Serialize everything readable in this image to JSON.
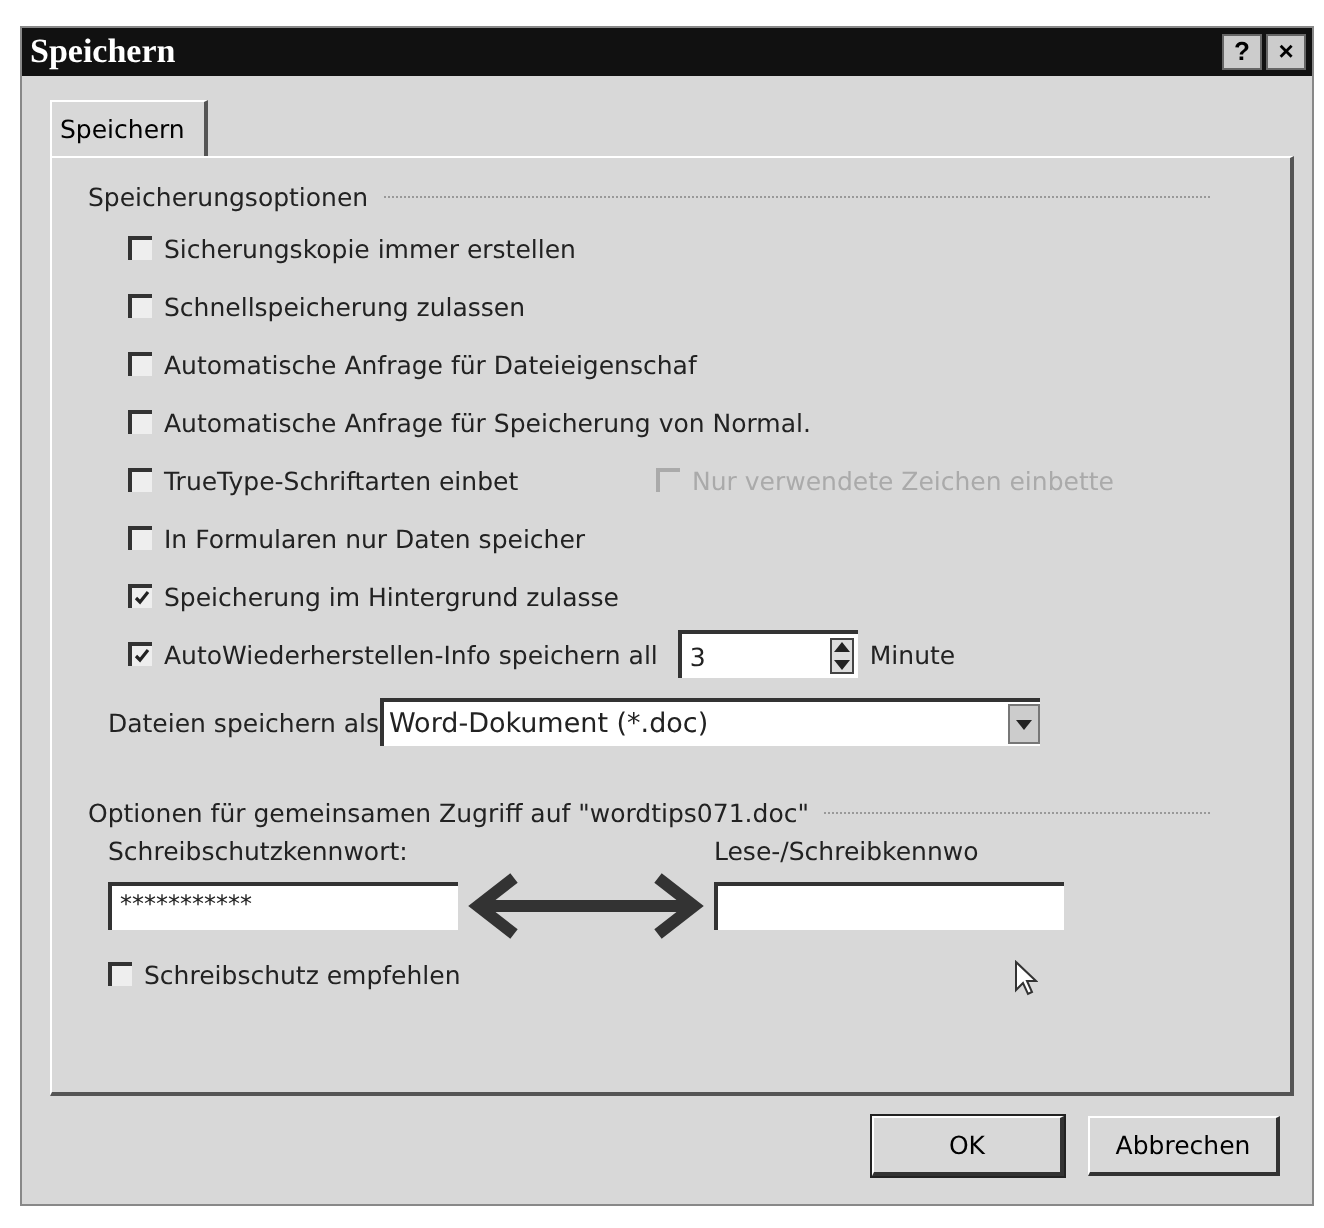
{
  "window": {
    "title": "Speichern",
    "help_button": "?",
    "close_button": "×"
  },
  "tabs": [
    {
      "label": "Speichern",
      "selected": true
    }
  ],
  "save_options": {
    "heading": "Speicherungsoptionen",
    "options": [
      {
        "kind": "checkbox",
        "label": "Sicherungskopie immer erstellen",
        "checked": false,
        "disabled": false
      },
      {
        "kind": "checkbox",
        "label": "Schnellspeicherung zulassen",
        "checked": false,
        "disabled": false
      },
      {
        "kind": "checkbox",
        "label": "Automatische Anfrage für Dateieigenschaf",
        "checked": false,
        "disabled": false
      },
      {
        "kind": "checkbox",
        "label": "Automatische Anfrage für Speicherung von Normal.",
        "checked": false,
        "disabled": false
      },
      {
        "kind": "pair",
        "label": "TrueType-Schriftarten einbet",
        "checked": false,
        "disabled": false,
        "second": {
          "label": "Nur verwendete Zeichen einbette",
          "checked": false,
          "disabled": true
        }
      },
      {
        "kind": "checkbox",
        "label": "In Formularen nur Daten speicher",
        "checked": false,
        "disabled": false
      },
      {
        "kind": "checkbox",
        "label": "Speicherung im Hintergrund zulasse",
        "checked": true,
        "disabled": false
      },
      {
        "kind": "spinner",
        "label": "AutoWiederherstellen-Info speichern all",
        "checked": true,
        "disabled": false,
        "value": "3",
        "unit": "Minute"
      }
    ],
    "format": {
      "label": "Dateien speichern als",
      "value": "Word-Dokument (*.doc)"
    }
  },
  "sharing": {
    "heading": "Optionen für gemeinsamen Zugriff auf \"wordtips071.doc\"",
    "write_password": {
      "label": "Schreibschutzkennwort:",
      "value": "***********"
    },
    "read_password": {
      "label": "Lese-/Schreibkennwo"
    },
    "recommend": {
      "label": "Schreibschutz empfehlen",
      "checked": false,
      "disabled": false
    }
  },
  "buttons": [
    {
      "label": "OK",
      "default": true
    },
    {
      "label": "Abbrechen",
      "default": false
    }
  ]
}
